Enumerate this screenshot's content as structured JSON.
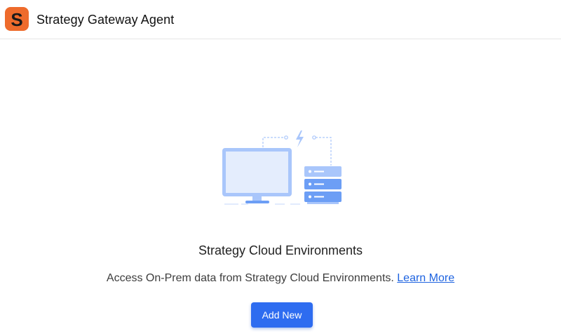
{
  "header": {
    "logo_letter": "S",
    "title": "Strategy Gateway Agent",
    "logo_color": "#ee6b2c"
  },
  "main": {
    "heading": "Strategy Cloud Environments",
    "description": "Access On-Prem data from Strategy Cloud Environments.",
    "learn_more_label": "Learn More",
    "add_button_label": "Add New"
  },
  "colors": {
    "accent": "#2e6cf0",
    "link": "#1e63e0",
    "illustration_light": "#a9c6fb",
    "illustration_dark": "#6c9ef5"
  }
}
